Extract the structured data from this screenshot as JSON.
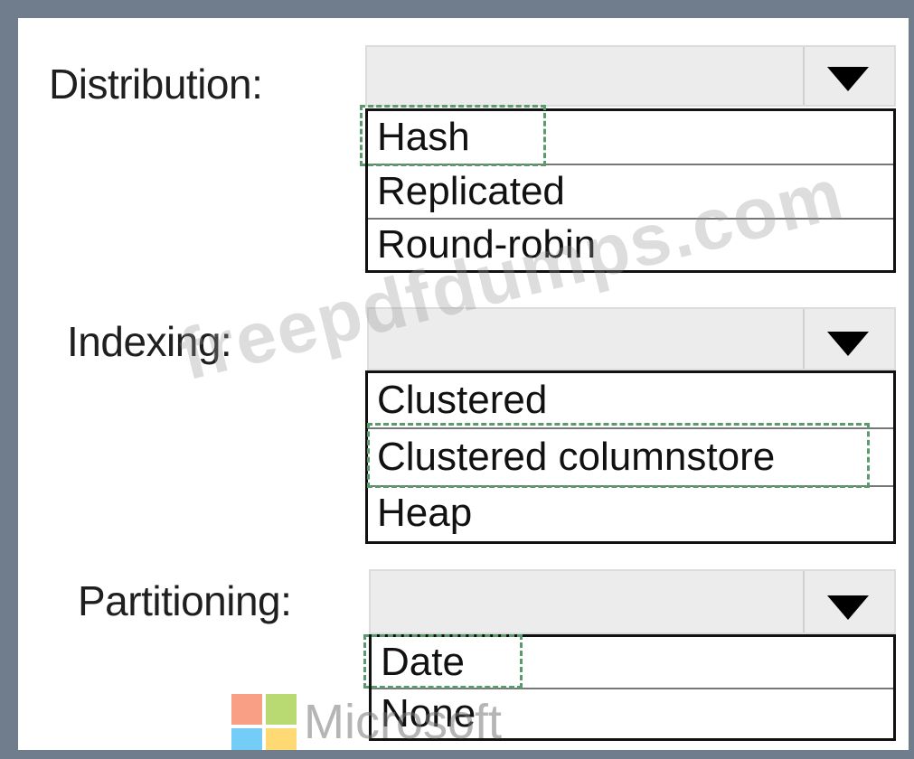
{
  "fields": [
    {
      "label": "Distribution:",
      "options": [
        "Hash",
        "Replicated",
        "Round-robin"
      ],
      "selected": "Hash"
    },
    {
      "label": "Indexing:",
      "options": [
        "Clustered",
        "Clustered columnstore",
        "Heap"
      ],
      "selected": "Clustered columnstore"
    },
    {
      "label": "Partitioning:",
      "options": [
        "Date",
        "None"
      ],
      "selected": "Date"
    }
  ],
  "watermark": "freepdfdumps.com",
  "logo_text": "Microsoft",
  "colors": {
    "frame": "#6f7d8d",
    "dropdown_bg": "#ececec",
    "selection_dash": "#5a9a6e"
  }
}
